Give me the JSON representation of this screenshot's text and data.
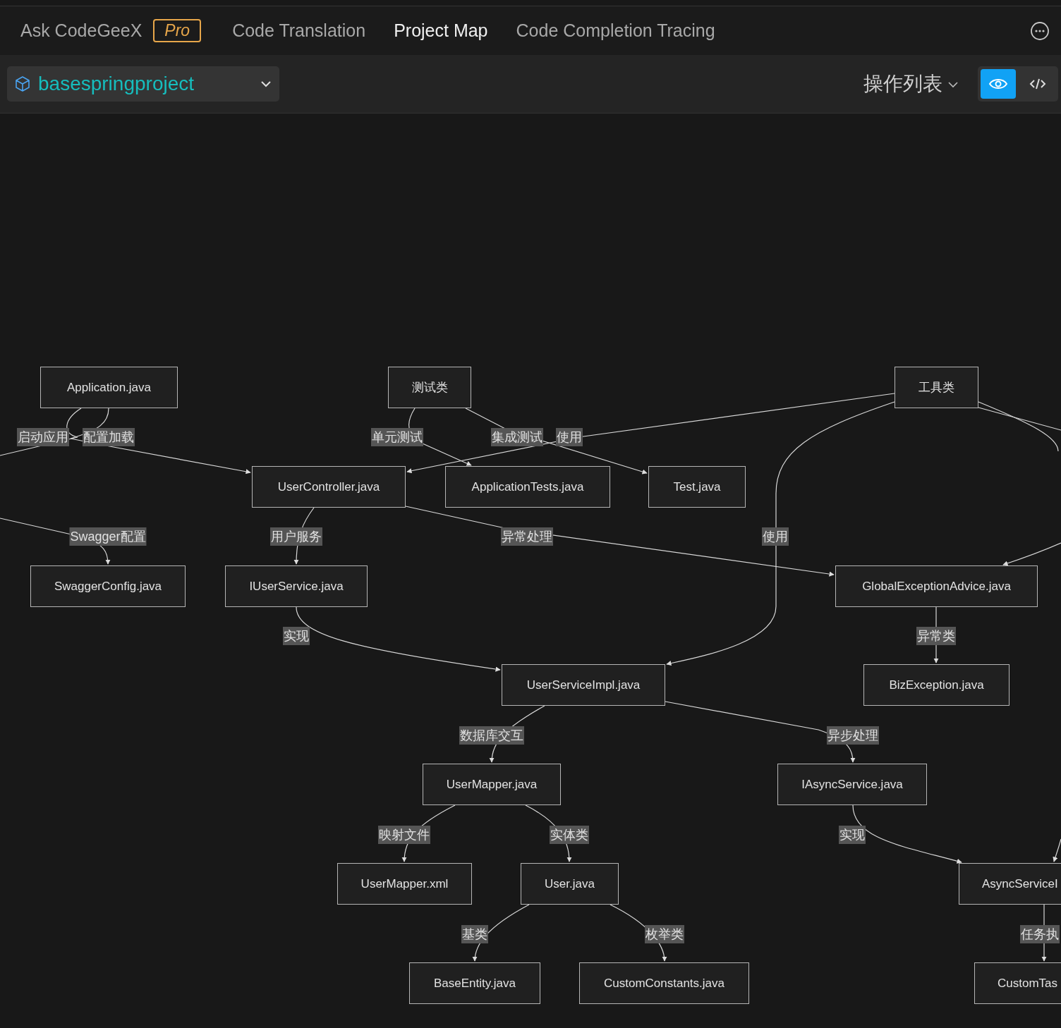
{
  "tabs": [
    {
      "label": "Ask CodeGeeX",
      "badge": "Pro",
      "selected": false
    },
    {
      "label": "Code Translation",
      "selected": false
    },
    {
      "label": "Project Map",
      "selected": true
    },
    {
      "label": "Code Completion Tracing",
      "selected": false
    }
  ],
  "project_select": {
    "value": "basespringproject"
  },
  "actions_menu": {
    "label": "操作列表"
  },
  "view_toggle": [
    {
      "kind": "preview",
      "selected": true
    },
    {
      "kind": "code",
      "selected": false
    }
  ],
  "diagram": {
    "nodes": [
      {
        "label": "Application.java"
      },
      {
        "label": "测试类"
      },
      {
        "label": "工具类"
      },
      {
        "label": "UserController.java"
      },
      {
        "label": "ApplicationTests.java"
      },
      {
        "label": "Test.java"
      },
      {
        "label": "SwaggerConfig.java"
      },
      {
        "label": "IUserService.java"
      },
      {
        "label": "GlobalExceptionAdvice.java"
      },
      {
        "label": "UserServiceImpl.java"
      },
      {
        "label": "BizException.java"
      },
      {
        "label": "UserMapper.java"
      },
      {
        "label": "IAsyncService.java"
      },
      {
        "label": "UserMapper.xml"
      },
      {
        "label": "User.java"
      },
      {
        "label": "AsyncServiceI"
      },
      {
        "label": "BaseEntity.java"
      },
      {
        "label": "CustomConstants.java"
      },
      {
        "label": "CustomTas"
      }
    ],
    "edge_labels": [
      "启动应用",
      "配置加载",
      "单元测试",
      "集成测试",
      "使用",
      "Swagger配置",
      "用户服务",
      "异常处理",
      "使用",
      "实现",
      "异常类",
      "数据库交互",
      "异步处理",
      "映射文件",
      "实体类",
      "实现",
      "基类",
      "枚举类",
      "任务执"
    ]
  }
}
